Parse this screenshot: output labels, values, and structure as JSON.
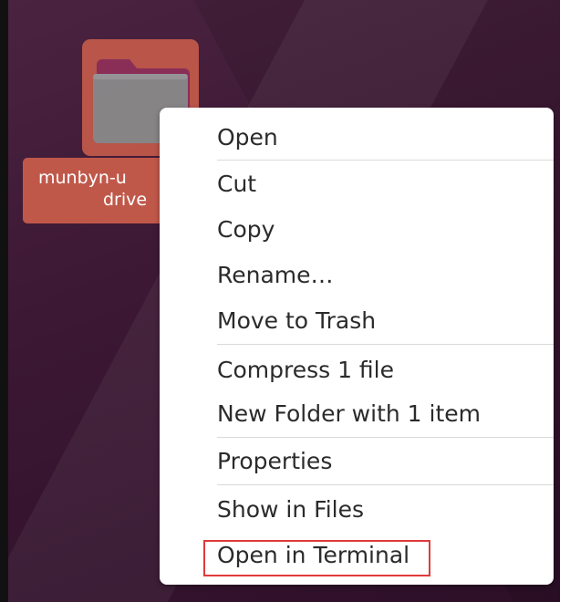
{
  "desktop": {
    "folder": {
      "icon": "folder-icon",
      "label_line1": "munbyn-u",
      "label_line2": "drive"
    }
  },
  "context_menu": {
    "items": [
      {
        "label": "Open"
      },
      {
        "label": "Cut"
      },
      {
        "label": "Copy"
      },
      {
        "label": "Rename…"
      },
      {
        "label": "Move to Trash"
      },
      {
        "label": "Compress 1 file"
      },
      {
        "label": "New Folder with 1 item"
      },
      {
        "label": "Properties"
      },
      {
        "label": "Show in Files"
      },
      {
        "label": "Open in Terminal"
      }
    ],
    "highlighted_item": "Open in Terminal",
    "highlight_color": "#e03a3a"
  },
  "colors": {
    "selection": "#c0584a",
    "wallpaper": "#3b1733"
  }
}
